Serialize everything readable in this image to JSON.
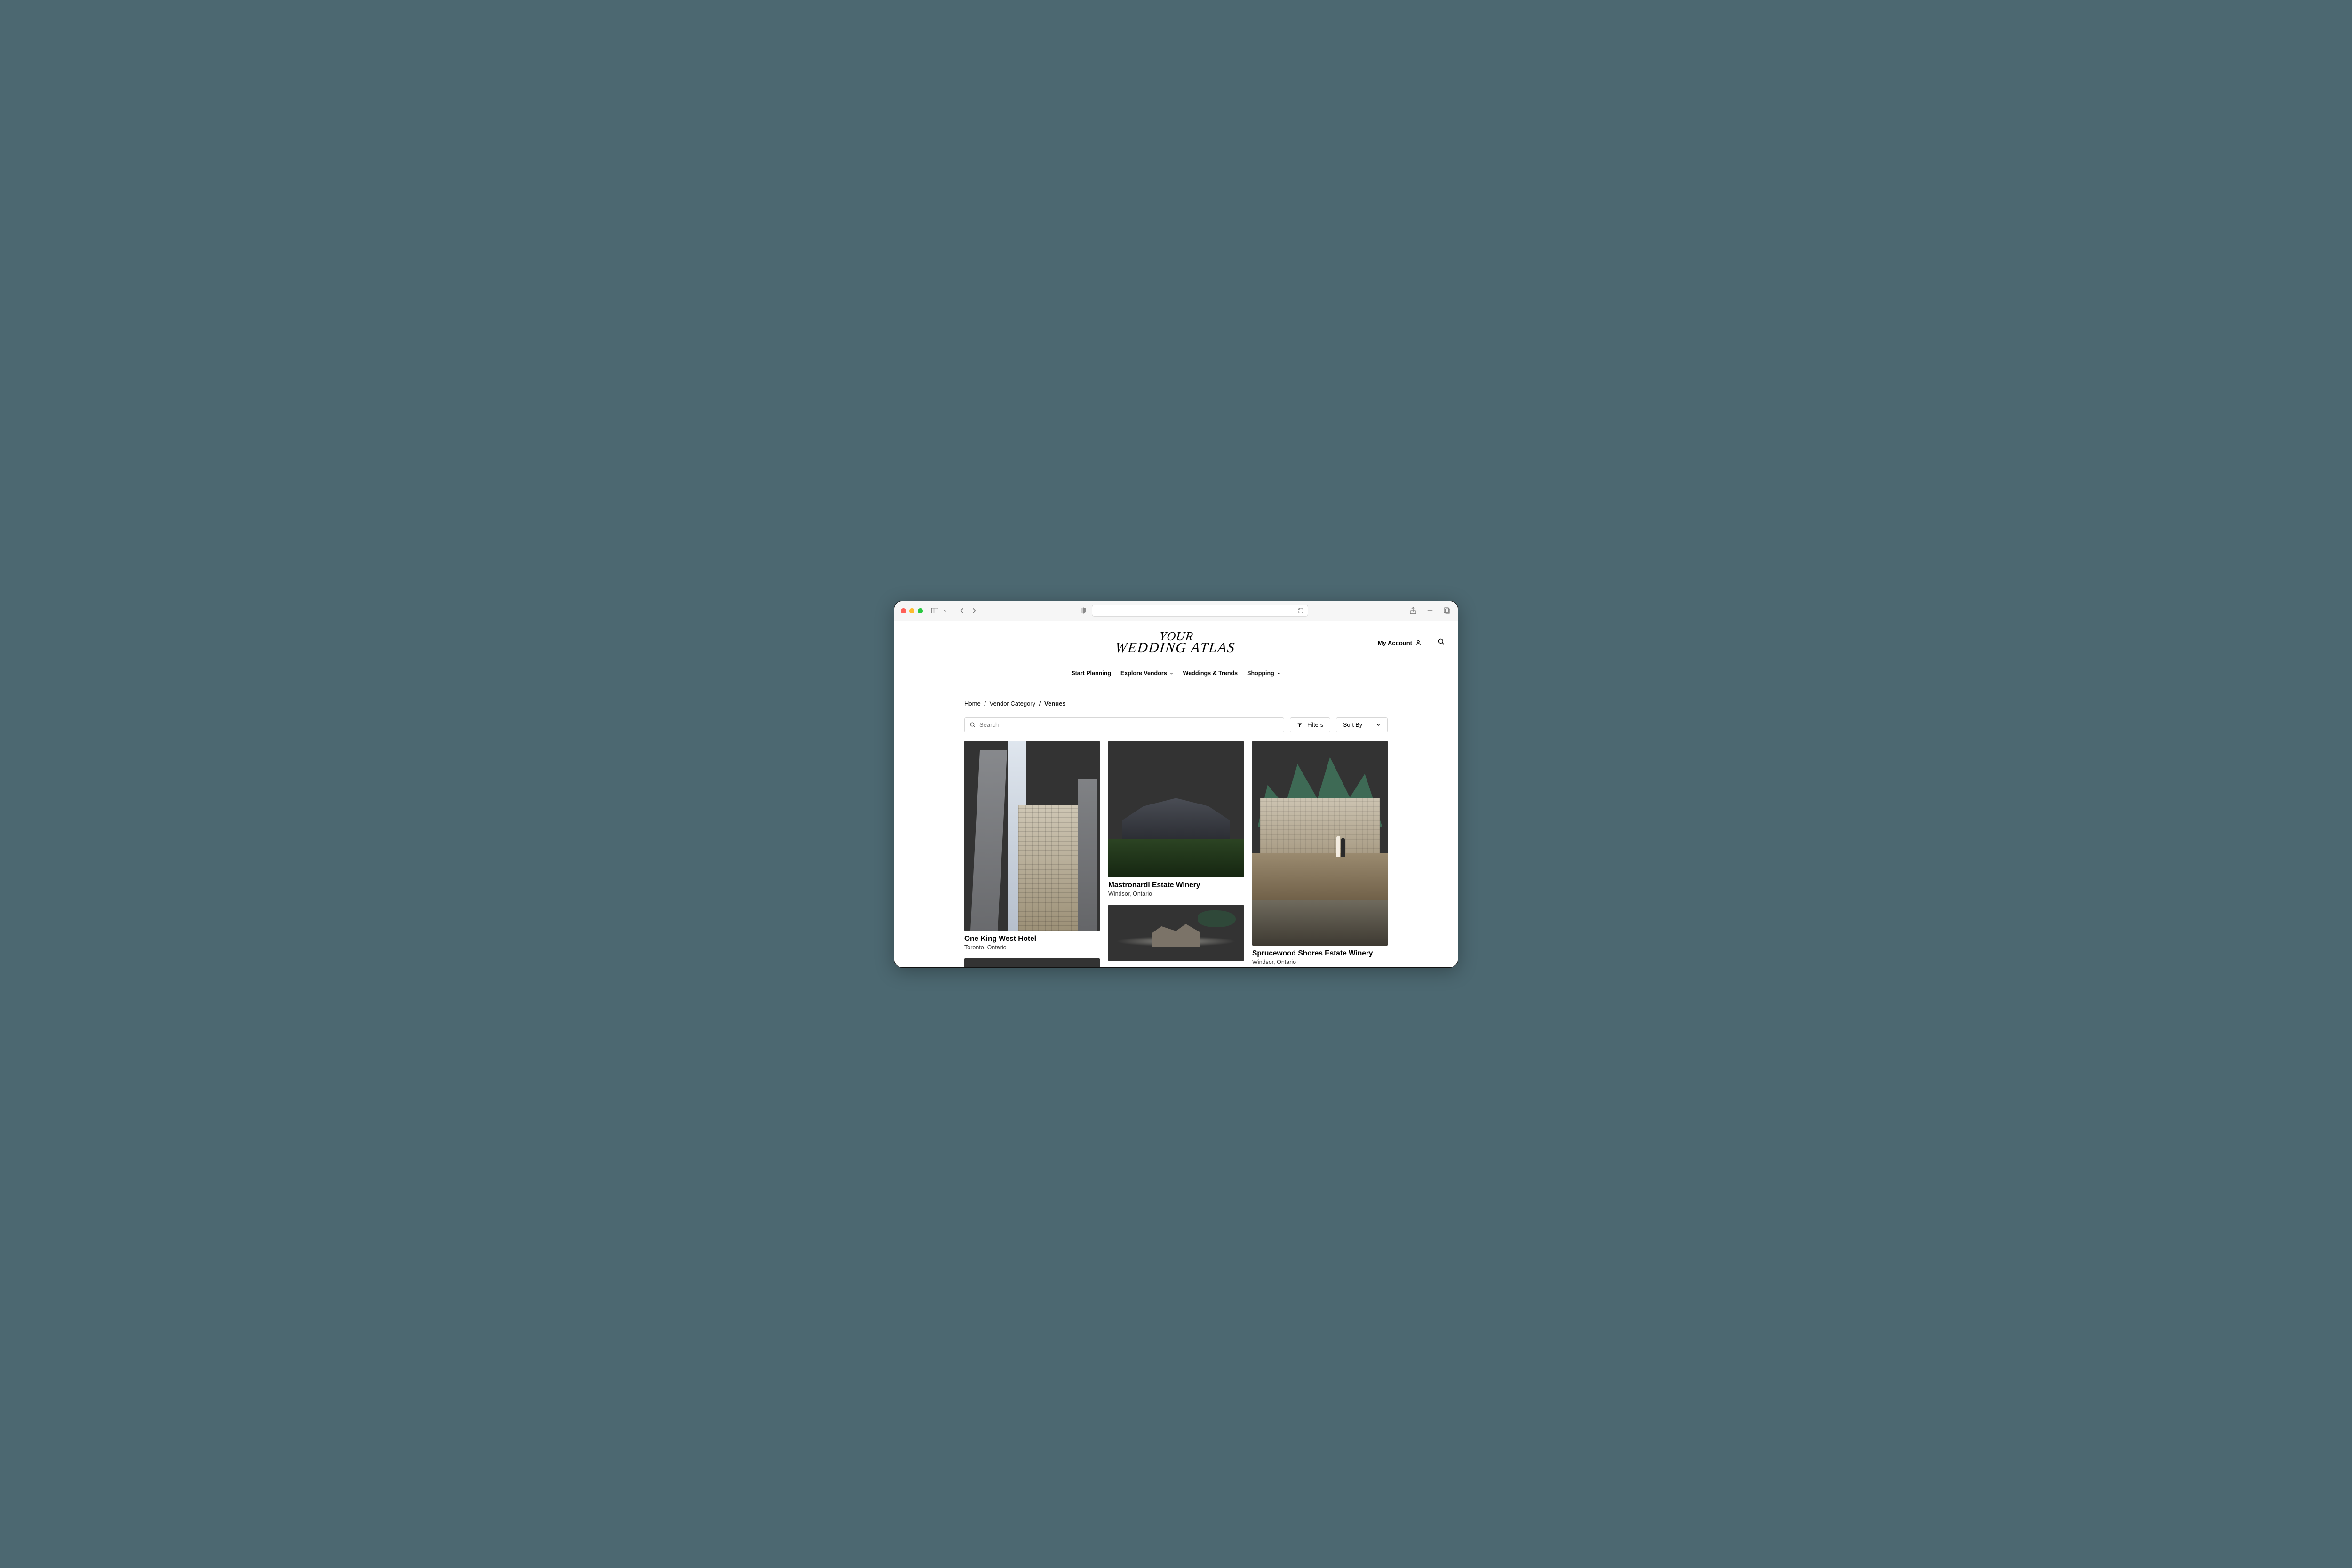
{
  "header": {
    "logo_line1": "YOUR",
    "logo_line2": "WEDDING ATLAS",
    "my_account_label": "My Account"
  },
  "nav": {
    "items": [
      {
        "label": "Start Planning",
        "has_dropdown": false
      },
      {
        "label": "Explore Vendors",
        "has_dropdown": true
      },
      {
        "label": "Weddings & Trends",
        "has_dropdown": false
      },
      {
        "label": "Shopping",
        "has_dropdown": true
      }
    ]
  },
  "breadcrumb": {
    "home": "Home",
    "category": "Vendor Category",
    "current": "Venues"
  },
  "controls": {
    "search_placeholder": "Search",
    "filters_label": "Filters",
    "sort_label": "Sort By"
  },
  "venues": [
    {
      "name": "One King West Hotel",
      "location": "Toronto, Ontario"
    },
    {
      "name": "Mastronardi Estate Winery",
      "location": "Windsor, Ontario"
    },
    {
      "name": "Sprucewood Shores Estate Winery",
      "location": "Windsor, Ontario"
    }
  ]
}
